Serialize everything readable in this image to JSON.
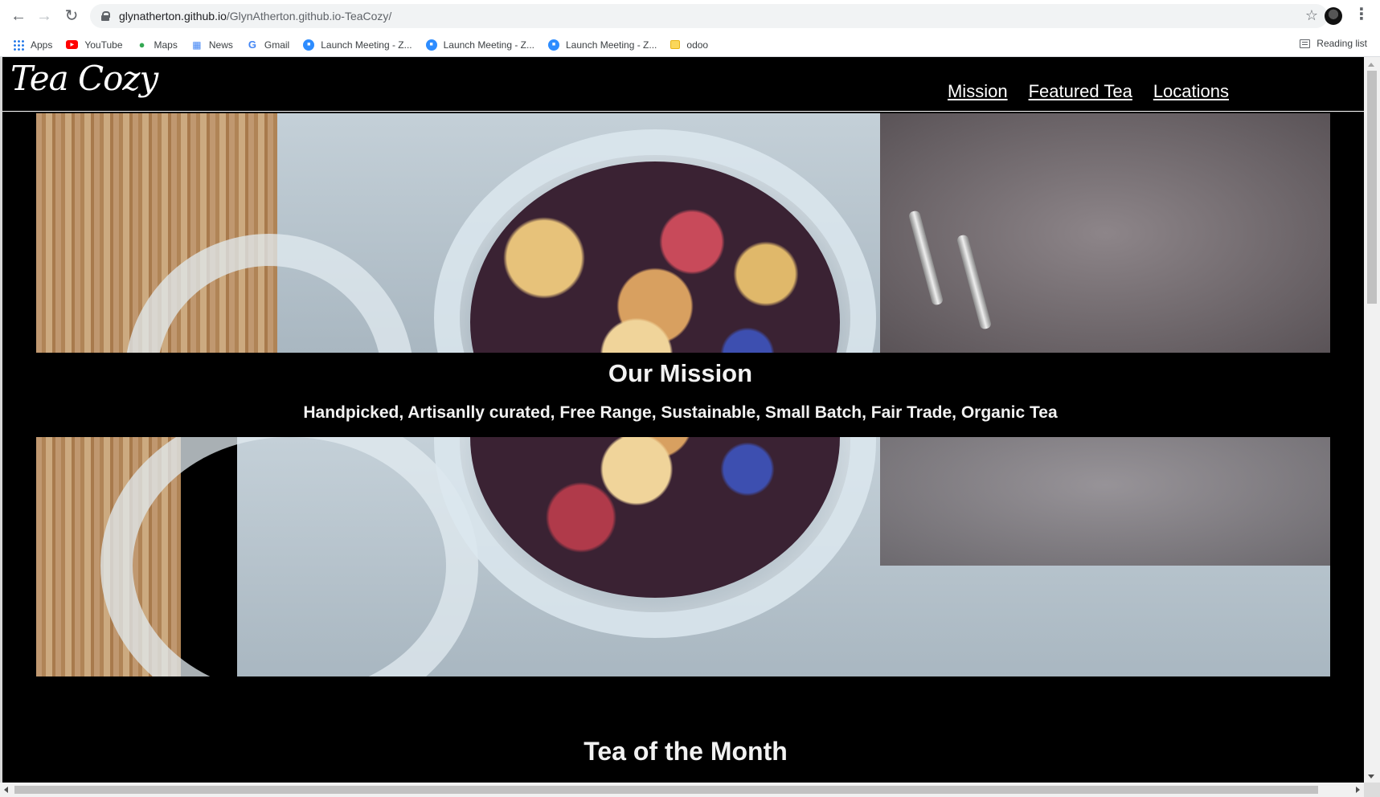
{
  "browser": {
    "url_host": "glynatherton.github.io",
    "url_path": "/GlynAtherton.github.io-TeaCozy/",
    "bookmarks": [
      {
        "label": "Apps",
        "icon": "apps-grid-icon"
      },
      {
        "label": "YouTube",
        "icon": "youtube-icon"
      },
      {
        "label": "Maps",
        "icon": "maps-icon"
      },
      {
        "label": "News",
        "icon": "news-icon"
      },
      {
        "label": "Gmail",
        "icon": "google-icon"
      },
      {
        "label": "Launch Meeting - Z...",
        "icon": "zoom-icon"
      },
      {
        "label": "Launch Meeting - Z...",
        "icon": "zoom-icon"
      },
      {
        "label": "Launch Meeting - Z...",
        "icon": "zoom-icon"
      },
      {
        "label": "odoo",
        "icon": "folder-icon"
      }
    ],
    "reading_list": "Reading list"
  },
  "site": {
    "logo": "Tea Cozy",
    "nav": [
      "Mission",
      "Featured Tea",
      "Locations"
    ],
    "mission_title": "Our Mission",
    "mission_subtitle": "Handpicked, Artisanlly curated, Free Range, Sustainable, Small Batch, Fair Trade, Organic Tea",
    "tea_of_month_title": "Tea of the Month"
  },
  "colors": {
    "page_background": "#000000",
    "text": "#f2f2f2",
    "omnibox": "#f1f3f4"
  }
}
